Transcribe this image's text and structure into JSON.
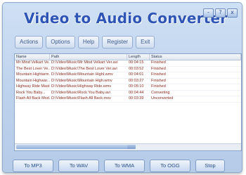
{
  "app": {
    "title": "Video to Audio Converter",
    "window_buttons": [
      "-",
      "?",
      "x"
    ]
  },
  "menu": {
    "items": [
      "Actions",
      "Options",
      "Help",
      "Register",
      "Exit"
    ]
  },
  "table": {
    "headers": [
      "Name",
      "Path",
      "Length",
      "Status"
    ],
    "rows": [
      [
        "Mr Mind Velkart Ve...",
        "D:\\Video\\Music\\Mr Mind Velkart Ver.avi",
        "00:04:15",
        "Finished"
      ],
      [
        "The Best Lover Ve...",
        "D:\\Video\\Music\\The Best Lover Ver.avi",
        "00:03:52",
        "Finished"
      ],
      [
        "Mountain Hightarm...",
        "D:\\Video\\Music\\Mountain Highl.wmv",
        "00:04:01",
        "Finished"
      ],
      [
        "Mountain Highwar...",
        "D:\\Video\\Music\\Mountain High.wmv",
        "00:03:27",
        "Finished"
      ],
      [
        "Highway Ride Mast...",
        "D:\\Video\\Music\\Highway Ride.wmv",
        "00:05:10",
        "Finished"
      ],
      [
        "Rock You Baby...",
        "D:\\Video\\Music\\Rock You Baby.avi",
        "00:04:44",
        "Converting"
      ],
      [
        "Flash All Back Mod...",
        "D:\\Video\\Music\\Flash All Back.mov",
        "00:03:39",
        "Unconverted"
      ]
    ]
  },
  "bottom_buttons": {
    "mp3": "To MP3",
    "wav": "To WAV",
    "wma": "To WMA",
    "ogg": "To OGG",
    "stop": "Stop"
  },
  "colors": {
    "accent": "#2e55b5",
    "row_text": "#8a2a1e",
    "window_bg": "#c4d6ee"
  }
}
